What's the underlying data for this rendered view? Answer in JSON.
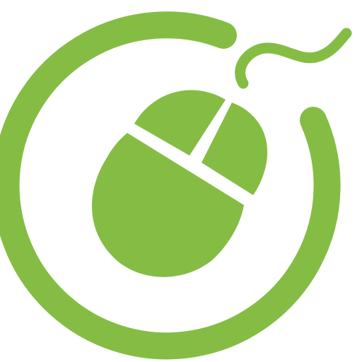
{
  "icon": {
    "name": "computer-mouse-in-ring-icon",
    "parts": [
      "ring",
      "mouse-cable",
      "mouse-left-button",
      "mouse-right-button",
      "mouse-body"
    ]
  },
  "colors": {
    "background": "#ffffff",
    "accent": "#85BD44"
  }
}
